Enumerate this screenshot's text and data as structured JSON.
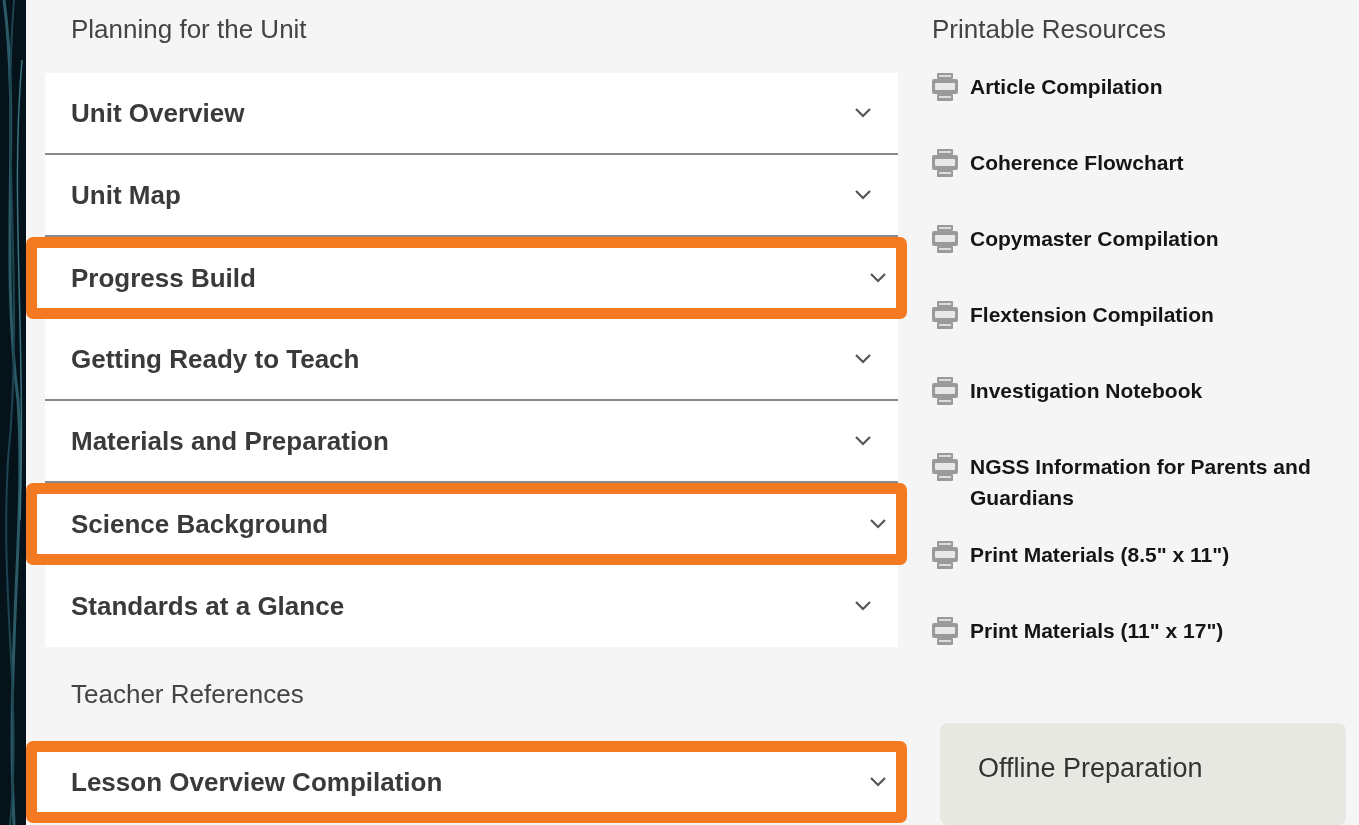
{
  "planning": {
    "heading": "Planning for the Unit",
    "items": [
      {
        "label": "Unit Overview",
        "highlighted": false
      },
      {
        "label": "Unit Map",
        "highlighted": false
      },
      {
        "label": "Progress Build",
        "highlighted": true
      },
      {
        "label": "Getting Ready to Teach",
        "highlighted": false
      },
      {
        "label": "Materials and Preparation",
        "highlighted": false
      },
      {
        "label": "Science Background",
        "highlighted": true
      },
      {
        "label": "Standards at a Glance",
        "highlighted": false
      }
    ]
  },
  "teacher_references": {
    "heading": "Teacher References",
    "items": [
      {
        "label": "Lesson Overview Compilation",
        "highlighted": true
      }
    ]
  },
  "printable_resources": {
    "heading": "Printable Resources",
    "items": [
      "Article Compilation",
      "Coherence Flowchart",
      "Copymaster Compilation",
      "Flextension Compilation",
      "Investigation Notebook",
      "NGSS Information for Parents and Guardians",
      "Print Materials (8.5\" x 11\")",
      "Print Materials (11\" x 17\")"
    ]
  },
  "offline_preparation": {
    "title": "Offline Preparation"
  }
}
